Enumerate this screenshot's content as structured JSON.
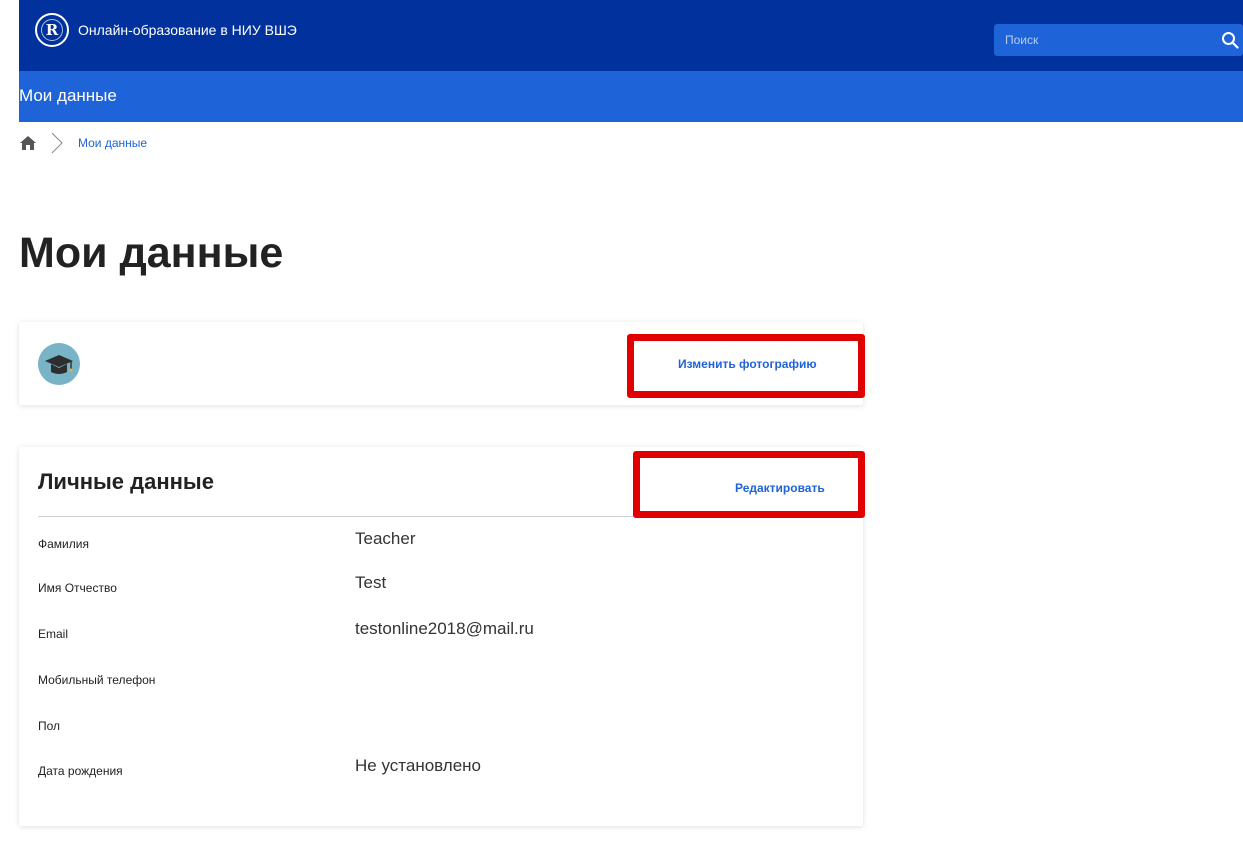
{
  "header": {
    "site_title": "Онлайн-образование в НИУ ВШЭ",
    "logo_glyph": "R",
    "search_placeholder": "Поиск",
    "search_icon": "search-icon",
    "bg_color": "#00319c",
    "accent_color": "#1f63d8"
  },
  "subheader": {
    "title": "Мои данные"
  },
  "breadcrumb": {
    "home_icon": "home-icon",
    "separator_icon": "chevron-right-icon",
    "current": "Мои данные"
  },
  "page": {
    "title": "Мои данные"
  },
  "photo_card": {
    "avatar_icon": "graduation-cap-avatar-icon",
    "change_photo_label": "Изменить фотографию"
  },
  "personal_data": {
    "title": "Личные данные",
    "edit_label": "Редактировать",
    "fields": [
      {
        "label": "Фамилия",
        "value": "Teacher"
      },
      {
        "label": "Имя Отчество",
        "value": "Test"
      },
      {
        "label": "Email",
        "value": "testonline2018@mail.ru"
      },
      {
        "label": "Мобильный телефон",
        "value": ""
      },
      {
        "label": "Пол",
        "value": ""
      },
      {
        "label": "Дата рождения",
        "value": "Не установлено"
      }
    ]
  },
  "highlight_color": "#e00000"
}
